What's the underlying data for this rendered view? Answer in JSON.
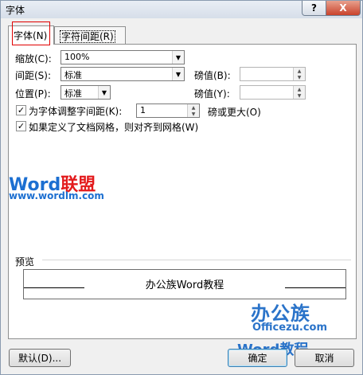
{
  "window": {
    "title": "字体",
    "help_glyph": "?",
    "close_glyph": "X"
  },
  "tabs": {
    "font": "字体(N)",
    "spacing": "字符间距(R)"
  },
  "fields": {
    "scale": {
      "label": "缩放(C):",
      "value": "100%"
    },
    "spacing": {
      "label": "间距(S):",
      "value": "标准",
      "by_label": "磅值(B):",
      "by_value": ""
    },
    "position": {
      "label": "位置(P):",
      "value": "标准",
      "by_label": "磅值(Y):",
      "by_value": ""
    },
    "kerning": {
      "label": "为字体调整字间距(K):",
      "value": "1",
      "suffix": "磅或更大(O)",
      "checked": true
    },
    "snap_grid": {
      "label": "如果定义了文档网格，则对齐到网格(W)",
      "checked": true
    }
  },
  "watermark": {
    "brand_word": "Word",
    "brand_cn": "联盟",
    "url": "www.wordlm.com"
  },
  "preview": {
    "label": "预览",
    "text": "办公族Word教程"
  },
  "branding": {
    "line1": "办公族",
    "line2": "Officezu.com",
    "line3": "Word教程"
  },
  "buttons": {
    "default": "默认(D)...",
    "ok": "确定",
    "cancel": "取消"
  }
}
